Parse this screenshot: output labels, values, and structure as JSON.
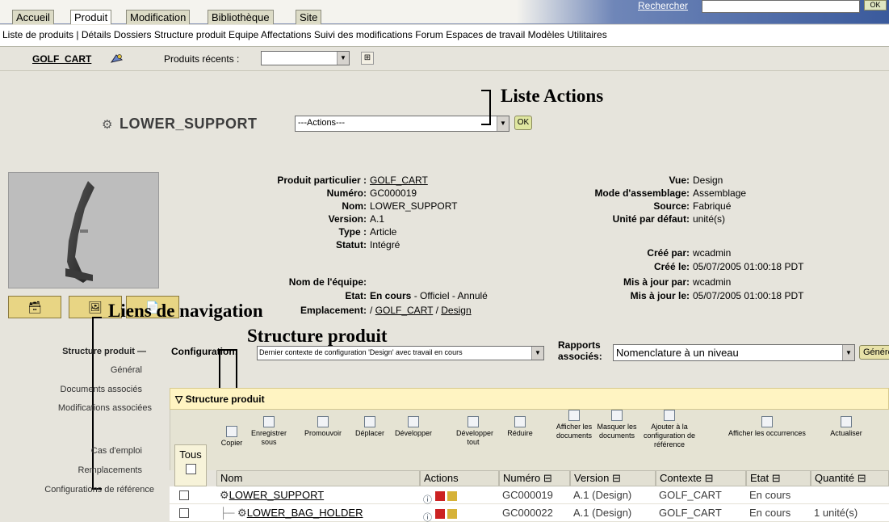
{
  "tabs": [
    "Accueil",
    "Produit",
    "Modification",
    "Bibliothèque",
    "Site"
  ],
  "active_tab": "Produit",
  "search": {
    "link": "Rechercher",
    "ok": "OK"
  },
  "subnav": [
    "Liste de produits | Détails",
    "Dossiers",
    "Structure produit",
    "Equipe",
    "Affectations",
    "Suivi des modifications",
    "Forum",
    "Espaces de travail",
    "Modèles",
    "Utilitaires"
  ],
  "context": {
    "product": "GOLF_CART",
    "recent_label": "Produits récents :",
    "recent_value": ""
  },
  "annotations": {
    "actions": "Liste Actions",
    "navigation": "Liens de navigation",
    "structure": "Structure produit"
  },
  "product": {
    "title": "LOWER_SUPPORT",
    "actions_placeholder": "---Actions---",
    "ok": "OK"
  },
  "attributes_left": [
    {
      "label": "Produit particulier :",
      "value": "GOLF_CART"
    },
    {
      "label": "Numéro:",
      "value": "GC000019"
    },
    {
      "label": "Nom:",
      "value": "LOWER_SUPPORT"
    },
    {
      "label": "Version:",
      "value": "A.1"
    },
    {
      "label": "Type :",
      "value": "Article"
    },
    {
      "label": "Statut:",
      "value": "Intégré"
    },
    {
      "label": "Nom de l'équipe:",
      "value": ""
    },
    {
      "label": "Etat:",
      "value": "En cours",
      "value_suffix": " - Officiel - Annulé"
    },
    {
      "label": "Emplacement:",
      "value": "/ ",
      "link1": "GOLF_CART",
      "sep": " / ",
      "link2": "Design"
    }
  ],
  "attributes_right": [
    {
      "label": "Vue:",
      "value": "Design"
    },
    {
      "label": "Mode d'assemblage:",
      "value": "Assemblage"
    },
    {
      "label": "Source:",
      "value": "Fabriqué"
    },
    {
      "label": "Unité par défaut:",
      "value": "unité(s)"
    },
    {
      "label": "Créé par:",
      "value": "wcadmin"
    },
    {
      "label": "Créé le:",
      "value": "05/07/2005 01:00:18 PDT"
    },
    {
      "label": "Mis à jour par:",
      "value": "wcadmin"
    },
    {
      "label": "Mis à jour le:",
      "value": "05/07/2005 01:00:18 PDT"
    }
  ],
  "left_nav": [
    "Structure produit",
    "Général",
    "Documents associés",
    "Modifications associées",
    "Cas d'emploi",
    "Remplacements",
    "Configurations de référence"
  ],
  "config": {
    "label": "Configuration:",
    "value": "Dernier contexte de configuration 'Design' avec travail en cours",
    "reports_label_1": "Rapports",
    "reports_label_2": "associés:",
    "reports_value": "Nomenclature à un niveau",
    "generate": "Générer"
  },
  "panel": {
    "title": "Structure produit",
    "all_label": "Tous",
    "toolbar": [
      "Copier",
      "Enregistrer sous",
      "Promouvoir",
      "Déplacer",
      "Développer",
      "Développer tout",
      "Réduire",
      "Afficher les documents",
      "Masquer les documents",
      "Ajouter à la configuration de référence",
      "Afficher les occurrences",
      "Actualiser"
    ]
  },
  "table": {
    "headers": [
      "Nom",
      "Actions",
      "Numéro ⊟",
      "Version ⊟",
      "Contexte ⊟",
      "Etat ⊟",
      "Quantité ⊟"
    ],
    "rows": [
      {
        "name": "LOWER_SUPPORT",
        "number": "GC000019",
        "version": "A.1 (Design)",
        "context": "GOLF_CART",
        "state": "En cours",
        "quantity": ""
      },
      {
        "name": "LOWER_BAG_HOLDER",
        "number": "GC000022",
        "version": "A.1 (Design)",
        "context": "GOLF_CART",
        "state": "En cours",
        "quantity": "1 unité(s)"
      }
    ]
  },
  "colors": {
    "accent_yellow": "#e8d584",
    "tab_blue": "#3a5a9c",
    "panel_header": "#fff4c2"
  }
}
